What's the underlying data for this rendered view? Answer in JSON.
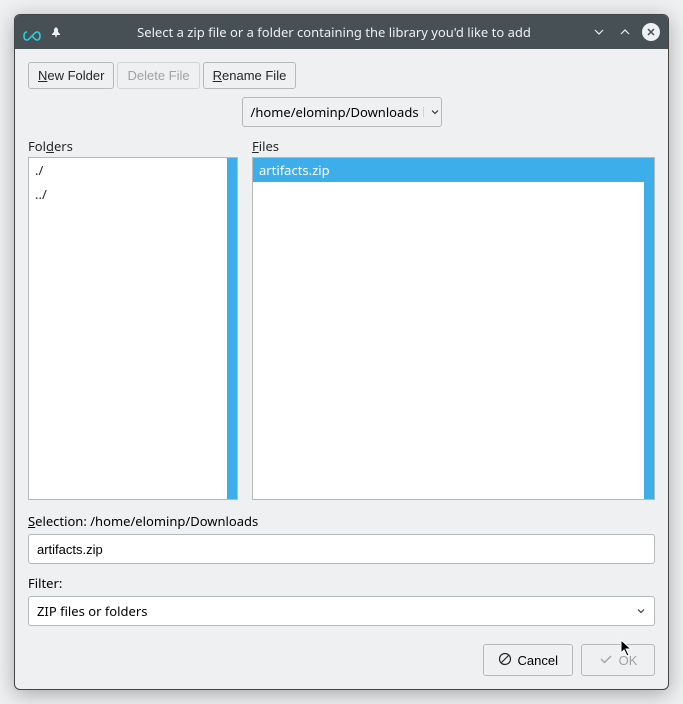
{
  "titlebar": {
    "title": "Select a zip file or a folder containing the library you'd like to add"
  },
  "toolbar": {
    "new_folder": "New Folder",
    "delete_file": "Delete File",
    "rename_file": "Rename File"
  },
  "path": {
    "value": "/home/elominp/Downloads"
  },
  "panes": {
    "folders_label": "Folders",
    "files_label": "Files",
    "folders": [
      {
        "name": "./"
      },
      {
        "name": "../"
      }
    ],
    "files": [
      {
        "name": "artifacts.zip",
        "selected": true
      }
    ]
  },
  "selection": {
    "label_prefix": "Selection: ",
    "path": "/home/elominp/Downloads",
    "value": "artifacts.zip"
  },
  "filter": {
    "label": "Filter:",
    "value": "ZIP files or folders"
  },
  "buttons": {
    "cancel": "Cancel",
    "ok": "OK"
  }
}
